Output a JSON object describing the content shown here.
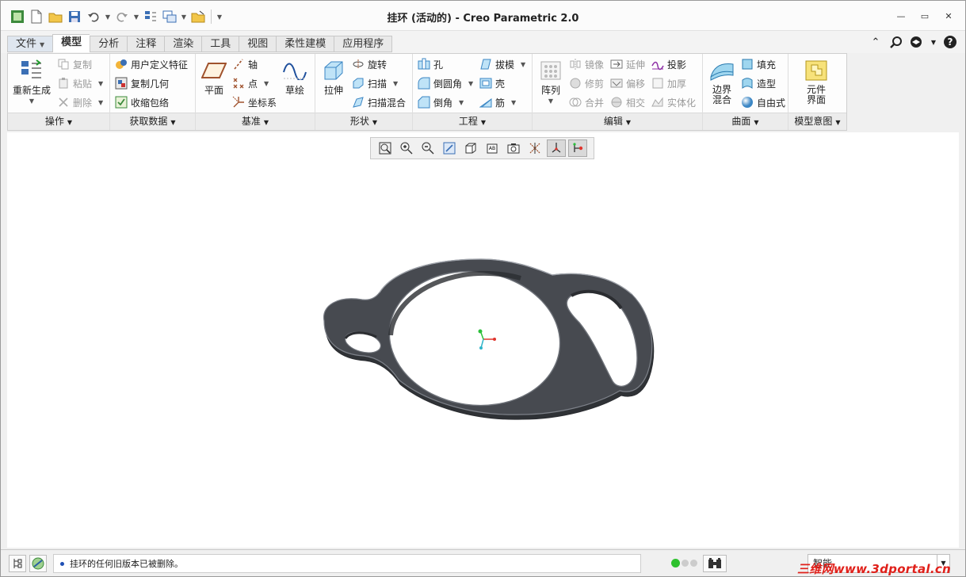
{
  "window": {
    "title": "挂环 (活动的) - Creo Parametric 2.0"
  },
  "quick_access": {
    "icons": [
      "app-icon",
      "new-file-icon",
      "open-file-icon",
      "save-icon",
      "undo-icon",
      "redo-icon",
      "regenerate-icon",
      "windows-icon",
      "close-window-icon",
      "customize-icon"
    ]
  },
  "tabs": [
    {
      "label": "文件",
      "has_dropdown": true
    },
    {
      "label": "模型",
      "active": true
    },
    {
      "label": "分析"
    },
    {
      "label": "注释"
    },
    {
      "label": "渲染"
    },
    {
      "label": "工具"
    },
    {
      "label": "视图"
    },
    {
      "label": "柔性建模"
    },
    {
      "label": "应用程序"
    }
  ],
  "ribbon": {
    "operations": {
      "label": "操作",
      "regenerate": "重新生成",
      "copy": "复制",
      "paste": "粘贴",
      "delete": "删除"
    },
    "get_data": {
      "label": "获取数据",
      "udf": "用户定义特征",
      "copy_geom": "复制几何",
      "shrinkwrap": "收缩包络"
    },
    "datum": {
      "label": "基准",
      "plane": "平面",
      "axis": "轴",
      "point": "点",
      "csys": "坐标系",
      "sketch": "草绘"
    },
    "shapes": {
      "label": "形状",
      "extrude": "拉伸",
      "revolve": "旋转",
      "sweep": "扫描",
      "swept_blend": "扫描混合"
    },
    "engineering": {
      "label": "工程",
      "hole": "孔",
      "round": "倒圆角",
      "chamfer": "倒角",
      "draft": "拔模",
      "shell": "壳",
      "rib": "筋"
    },
    "editing": {
      "label": "编辑",
      "pattern": "阵列",
      "mirror": "镜像",
      "trim": "修剪",
      "merge": "合并",
      "extend": "延伸",
      "offset": "偏移",
      "intersect": "相交",
      "project": "投影",
      "thicken": "加厚",
      "solidify": "实体化"
    },
    "surfaces": {
      "label": "曲面",
      "boundary_blend": "边界混合",
      "fill": "填充",
      "style": "造型",
      "freestyle": "自由式"
    },
    "model_intent": {
      "label": "模型意图",
      "component_interface": "元件界面"
    }
  },
  "status": {
    "message": "挂环的任何旧版本已被删除。",
    "filter": "智能",
    "watermark": "三维网www.3dportal.cn"
  },
  "colors": {
    "accent_tab": "#ffffff",
    "model_body": "#3a3d42",
    "model_edge": "#8a8e95"
  }
}
